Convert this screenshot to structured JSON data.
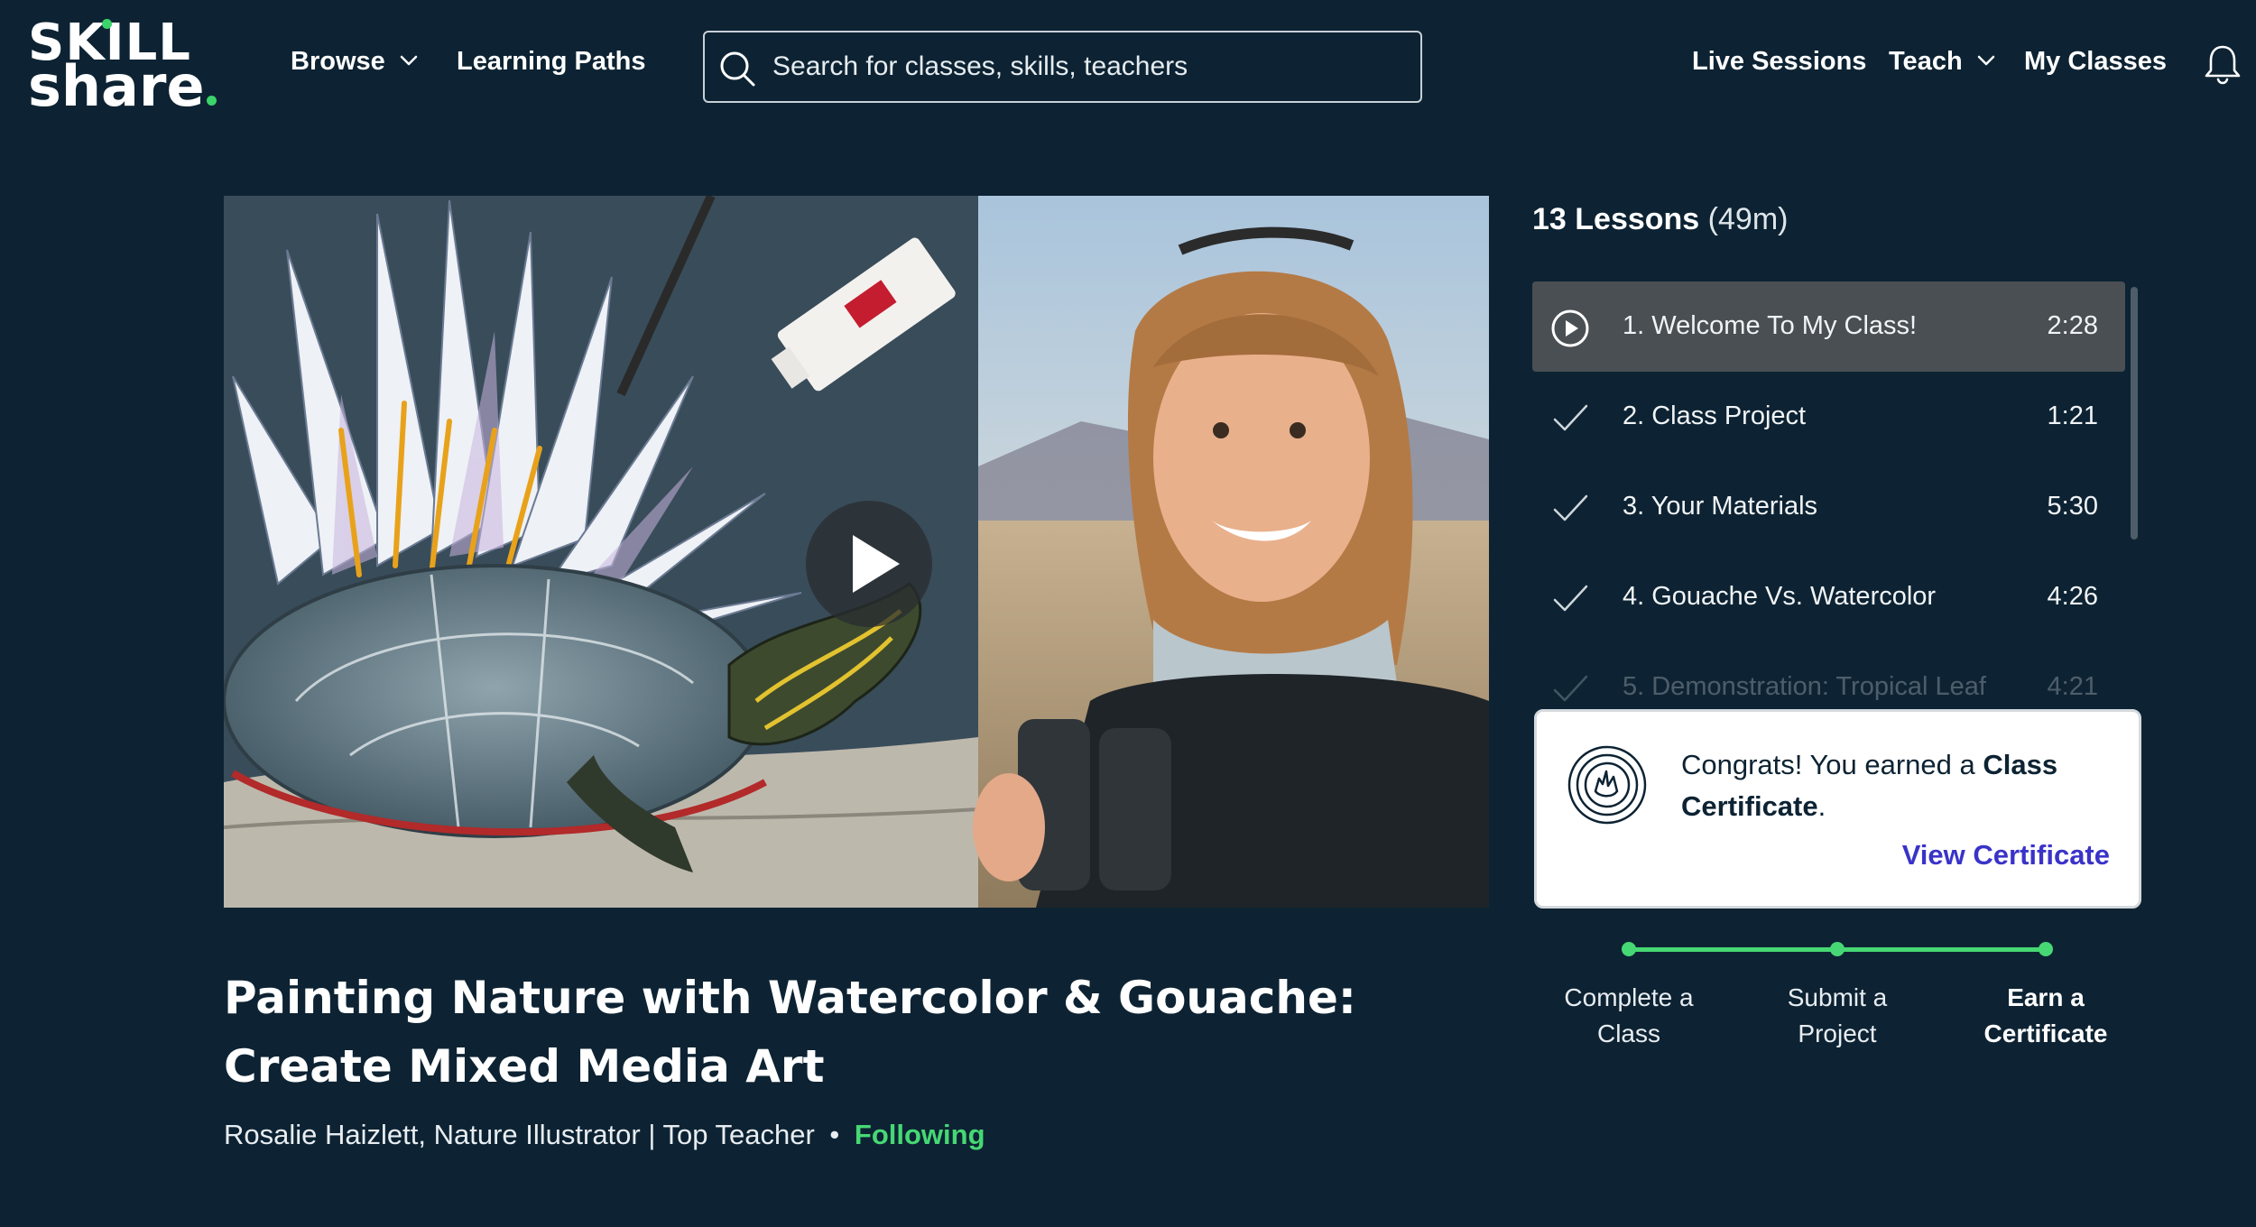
{
  "header": {
    "logo_line1": "SKILL",
    "logo_line2": "share",
    "nav": {
      "browse": "Browse",
      "learning_paths": "Learning Paths",
      "live_sessions": "Live Sessions",
      "teach": "Teach",
      "my_classes": "My Classes"
    },
    "search": {
      "placeholder": "Search for classes, skills, teachers",
      "value": ""
    },
    "icons": {
      "search": "search-icon",
      "bell": "bell-icon"
    }
  },
  "video": {
    "play_icon": "play-icon"
  },
  "class": {
    "title": "Painting Nature with Watercolor & Gouache: Create Mixed Media Art",
    "teacher": "Rosalie Haizlett, Nature Illustrator | Top Teacher",
    "separator": "•",
    "follow_status": "Following"
  },
  "lessons": {
    "count_label": "13 Lessons",
    "total_duration": "(49m)",
    "items": [
      {
        "title": "1. Welcome To My Class!",
        "duration": "2:28",
        "state": "playing"
      },
      {
        "title": "2. Class Project",
        "duration": "1:21",
        "state": "completed"
      },
      {
        "title": "3. Your Materials",
        "duration": "5:30",
        "state": "completed"
      },
      {
        "title": "4. Gouache Vs. Watercolor",
        "duration": "4:26",
        "state": "completed"
      },
      {
        "title": "5. Demonstration: Tropical Leaf",
        "duration": "4:21",
        "state": "completed"
      }
    ]
  },
  "certificate": {
    "message_prefix": "Congrats! You earned a",
    "message_bold": "Class Certificate",
    "message_suffix": ".",
    "link": "View Certificate",
    "badge_icon": "certificate-badge-icon"
  },
  "steps": [
    {
      "line1": "Complete a",
      "line2": "Class"
    },
    {
      "line1": "Submit a",
      "line2": "Project"
    },
    {
      "line1": "Earn a",
      "line2": "Certificate"
    }
  ],
  "colors": {
    "background": "#0d2333",
    "accent_green": "#46d874",
    "link_purple": "#3a33c9",
    "active_lesson": "#4a4f53"
  }
}
